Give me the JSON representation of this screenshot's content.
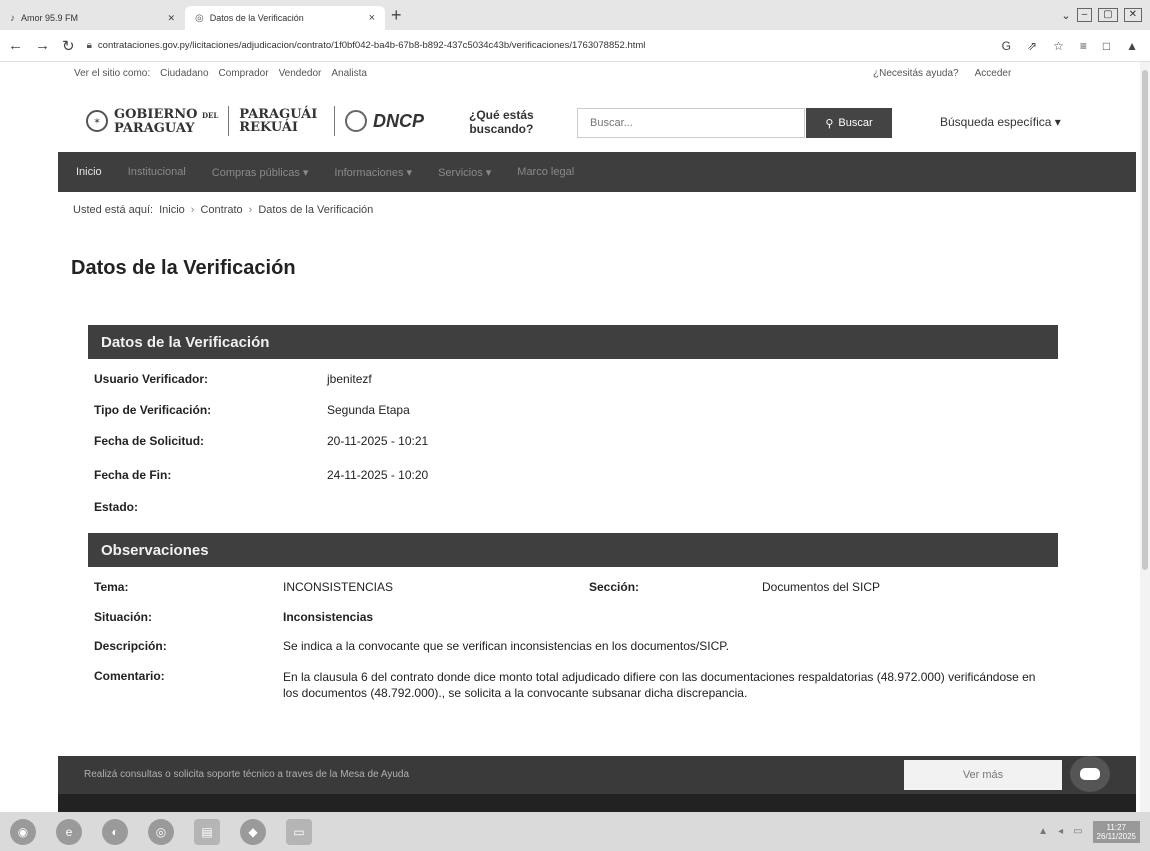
{
  "browser": {
    "tabs": [
      {
        "title": "Amor 95.9 FM",
        "icon": "music-icon",
        "mute_glyph": "✕"
      },
      {
        "title": "Datos de la Verificación",
        "icon": "page-icon",
        "close_glyph": "×"
      }
    ],
    "new_tab_glyph": "+",
    "url": "contrataciones.gov.py/licitaciones/adjudicacion/contrato/1f0bf042-ba4b-67b8-b892-437c5034c43b/verificaciones/1763078852.html",
    "toolbar_icons": [
      "G",
      "⇗",
      "☆",
      "≡",
      "□",
      "▲"
    ],
    "window_controls": [
      "⌄",
      "–",
      "▢",
      "✕"
    ]
  },
  "site": {
    "view_as_label": "Ver el sitio como:",
    "view_as_options": [
      "Ciudadano",
      "Comprador",
      "Vendedor",
      "Analista"
    ],
    "help_link": "¿Necesitás ayuda?",
    "login_link": "Acceder",
    "gov_logo_line1": "GOBIERNO",
    "gov_logo_del": "DEL",
    "gov_logo_line2": "PARAGUAY",
    "gov_logo_line3": "PARAGUÁI",
    "gov_logo_line4": "REKUÁI",
    "dncp_logo": "DNCP",
    "search_question_1": "¿Qué estás",
    "search_question_2": "buscando?",
    "search_placeholder": "Buscar...",
    "search_button": "Buscar",
    "advanced_search": "Búsqueda específica ▾"
  },
  "nav": [
    {
      "label": "Inicio"
    },
    {
      "label": "Institucional"
    },
    {
      "label": "Compras públicas ▾"
    },
    {
      "label": "Informaciones ▾"
    },
    {
      "label": "Servicios ▾"
    },
    {
      "label": "Marco legal"
    }
  ],
  "breadcrumb": {
    "prefix": "Usted está aquí:",
    "items": [
      "Inicio",
      "Contrato",
      "Datos de la Verificación"
    ],
    "separator": "›"
  },
  "page_title": "Datos de la Verificación",
  "verification": {
    "heading": "Datos de la Verificación",
    "fields": [
      {
        "label": "Usuario Verificador:",
        "value": "jbenitezf"
      },
      {
        "label": "Tipo de Verificación:",
        "value": "Segunda Etapa"
      },
      {
        "label": "Fecha de Solicitud:",
        "value": "20-11-2025 - 10:21"
      },
      {
        "label": "Fecha de Fin:",
        "value": "24-11-2025 - 10:20"
      },
      {
        "label": "Estado:",
        "value": ""
      }
    ]
  },
  "observations": {
    "heading": "Observaciones",
    "tema_label": "Tema:",
    "tema_value": "INCONSISTENCIAS",
    "seccion_label": "Sección:",
    "seccion_value": "Documentos del SICP",
    "situacion_label": "Situación:",
    "situacion_value": "Inconsistencias",
    "descripcion_label": "Descripción:",
    "descripcion_value": "Se indica a la convocante que se verifican inconsistencias en los documentos/SICP.",
    "comentario_label": "Comentario:",
    "comentario_value": "En la clausula 6 del contrato donde dice monto total adjudicado difiere con las documentaciones respaldatorias (48.972.000) verificándose en los documentos (48.792.000)., se solicita a la convocante subsanar dicha discrepancia."
  },
  "help_bar": {
    "message": "Realizá consultas o solicita soporte técnico a traves de la Mesa de Ayuda",
    "more_button": "Ver más"
  },
  "taskbar": {
    "time": "11:27",
    "date": "26/11/2025"
  },
  "colors": {
    "panel_header": "#3f3f3f",
    "nav_bar": "#3e3e3e",
    "search_button": "#444444"
  }
}
